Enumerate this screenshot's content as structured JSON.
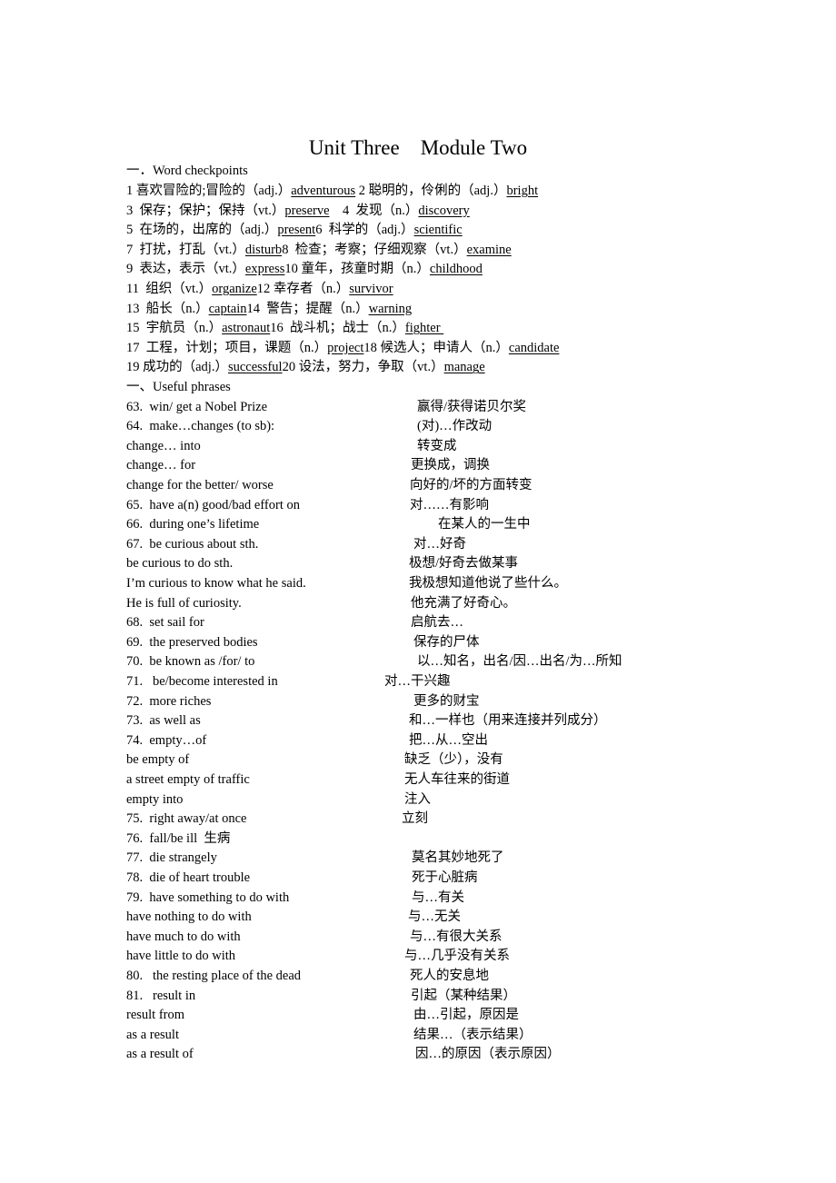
{
  "title": "Unit Three    Module Two",
  "section1": {
    "heading": "一．Word checkpoints",
    "lines": [
      [
        {
          "t": "1 喜欢冒险的;冒险的（adj.）"
        },
        {
          "t": "adventurous",
          "u": true
        },
        {
          "t": " 2 聪明的，伶俐的（adj.）"
        },
        {
          "t": "bright",
          "u": true
        }
      ],
      [
        {
          "t": "3  保存；保护；保持（vt.）"
        },
        {
          "t": "preserve",
          "u": true
        },
        {
          "t": "    4  发现（n.）"
        },
        {
          "t": "discovery",
          "u": true
        }
      ],
      [
        {
          "t": "5  在场的，出席的（adj.）"
        },
        {
          "t": "present",
          "u": true
        },
        {
          "t": "6  科学的（adj.）"
        },
        {
          "t": "scientific",
          "u": true
        }
      ],
      [
        {
          "t": "7  打扰，打乱（vt.）"
        },
        {
          "t": "disturb",
          "u": true
        },
        {
          "t": "8  检查；考察；仔细观察（vt.）"
        },
        {
          "t": "examine",
          "u": true
        }
      ],
      [
        {
          "t": "9  表达，表示（vt.）"
        },
        {
          "t": "express",
          "u": true
        },
        {
          "t": "10 童年，孩童时期（n.）"
        },
        {
          "t": "childhood",
          "u": true
        }
      ],
      [
        {
          "t": "11  组织（vt.）"
        },
        {
          "t": "organize",
          "u": true
        },
        {
          "t": "12 幸存者（n.）"
        },
        {
          "t": "survivor",
          "u": true
        }
      ],
      [
        {
          "t": "13  船长（n.）"
        },
        {
          "t": "captain",
          "u": true
        },
        {
          "t": "14  警告；提醒（n.）"
        },
        {
          "t": "warning",
          "u": true
        }
      ],
      [
        {
          "t": "15  宇航员（n.）"
        },
        {
          "t": "astronaut",
          "u": true
        },
        {
          "t": "16  战斗机；战士（n.）"
        },
        {
          "t": "fighter ",
          "u": true
        }
      ],
      [
        {
          "t": "17  工程，计划；项目，课题（n.）"
        },
        {
          "t": "project",
          "u": true
        },
        {
          "t": "18 候选人；申请人（n.）"
        },
        {
          "t": "candidate",
          "u": true
        }
      ],
      [
        {
          "t": "19 成功的（adj.）"
        },
        {
          "t": "successful",
          "u": true
        },
        {
          "t": "20 设法，努力，争取（vt.）"
        },
        {
          "t": "manage",
          "u": true
        }
      ]
    ]
  },
  "section2": {
    "heading": "一、Useful phrases",
    "rows": [
      {
        "en": "63.  win/ get a Nobel Prize",
        "zh": "赢得/获得诺贝尔奖",
        "zx": 459
      },
      {
        "en": "64.  make…changes (to sb):",
        "zh": "(对)…作改动",
        "zx": 459
      },
      {
        "en": "change… into",
        "zh": "转变成",
        "zx": 459
      },
      {
        "en": "change… for",
        "zh": "更换成，调换",
        "zx": 452
      },
      {
        "en": "change for the better/ worse",
        "zh": "向好的/坏的方面转变",
        "zx": 451
      },
      {
        "en": "65.  have a(n) good/bad effort on",
        "zh": "对……有影响",
        "zx": 451
      },
      {
        "en": "66.  during one’s lifetime",
        "zh": "在某人的一生中",
        "zx": 482
      },
      {
        "en": "67.  be curious about sth.",
        "zh": "对…好奇",
        "zx": 455
      },
      {
        "en": "be curious to do sth.",
        "zh": "极想/好奇去做某事",
        "zx": 450
      },
      {
        "en": "I’m curious to know what he said.",
        "zh": "我极想知道他说了些什么。",
        "zx": 450
      },
      {
        "en": "He is full of curiosity.",
        "zh": "他充满了好奇心。",
        "zx": 452
      },
      {
        "en": "68.  set sail for",
        "zh": "启航去…",
        "zx": 452
      },
      {
        "en": "69.  the preserved bodies",
        "zh": "保存的尸体",
        "zx": 455
      },
      {
        "en": "70.  be known as /for/ to",
        "zh": "以…知名，出名/因…出名/为…所知",
        "zx": 459
      },
      {
        "en": "71.   be/become interested in",
        "zh": "对…干兴趣",
        "zx": 423
      },
      {
        "en": "72.  more riches",
        "zh": "更多的财宝",
        "zx": 455
      },
      {
        "en": "73.  as well as",
        "zh": "和…一样也（用来连接并列成分）",
        "zx": 450
      },
      {
        "en": "74.  empty…of",
        "zh": "把…从…空出",
        "zx": 450
      },
      {
        "en": "be empty of",
        "zh": "缺乏（少），没有",
        "zx": 445
      },
      {
        "en": "a street empty of traffic",
        "zh": "无人车往来的街道",
        "zx": 445
      },
      {
        "en": "empty into",
        "zh": "注入",
        "zx": 445
      },
      {
        "en": "75.  right away/at once",
        "zh": "立刻",
        "zx": 442
      },
      {
        "en": "76.  fall/be ill  生病",
        "zh": "",
        "zx": 0
      },
      {
        "en": "77.  die strangely",
        "zh": "莫名其妙地死了",
        "zx": 453
      },
      {
        "en": "78.  die of heart trouble",
        "zh": "死于心脏病",
        "zx": 453
      },
      {
        "en": "79.  have something to do with",
        "zh": "与…有关",
        "zx": 453
      },
      {
        "en": "have nothing to do with",
        "zh": "与…无关",
        "zx": 449
      },
      {
        "en": "have much to do with",
        "zh": "与…有很大关系",
        "zx": 451
      },
      {
        "en": "have little to do with",
        "zh": "与…几乎没有关系",
        "zx": 445
      },
      {
        "en": "80.   the resting place of the dead",
        "zh": "死人的安息地",
        "zx": 451
      },
      {
        "en": "81.   result in",
        "zh": "引起（某种结果）",
        "zx": 452
      },
      {
        "en": "result from",
        "zh": "由…引起，原因是",
        "zx": 455
      },
      {
        "en": "as a result",
        "zh": "结果…（表示结果）",
        "zx": 455
      },
      {
        "en": "as a result of",
        "zh": "因…的原因（表示原因）",
        "zx": 457
      }
    ]
  }
}
